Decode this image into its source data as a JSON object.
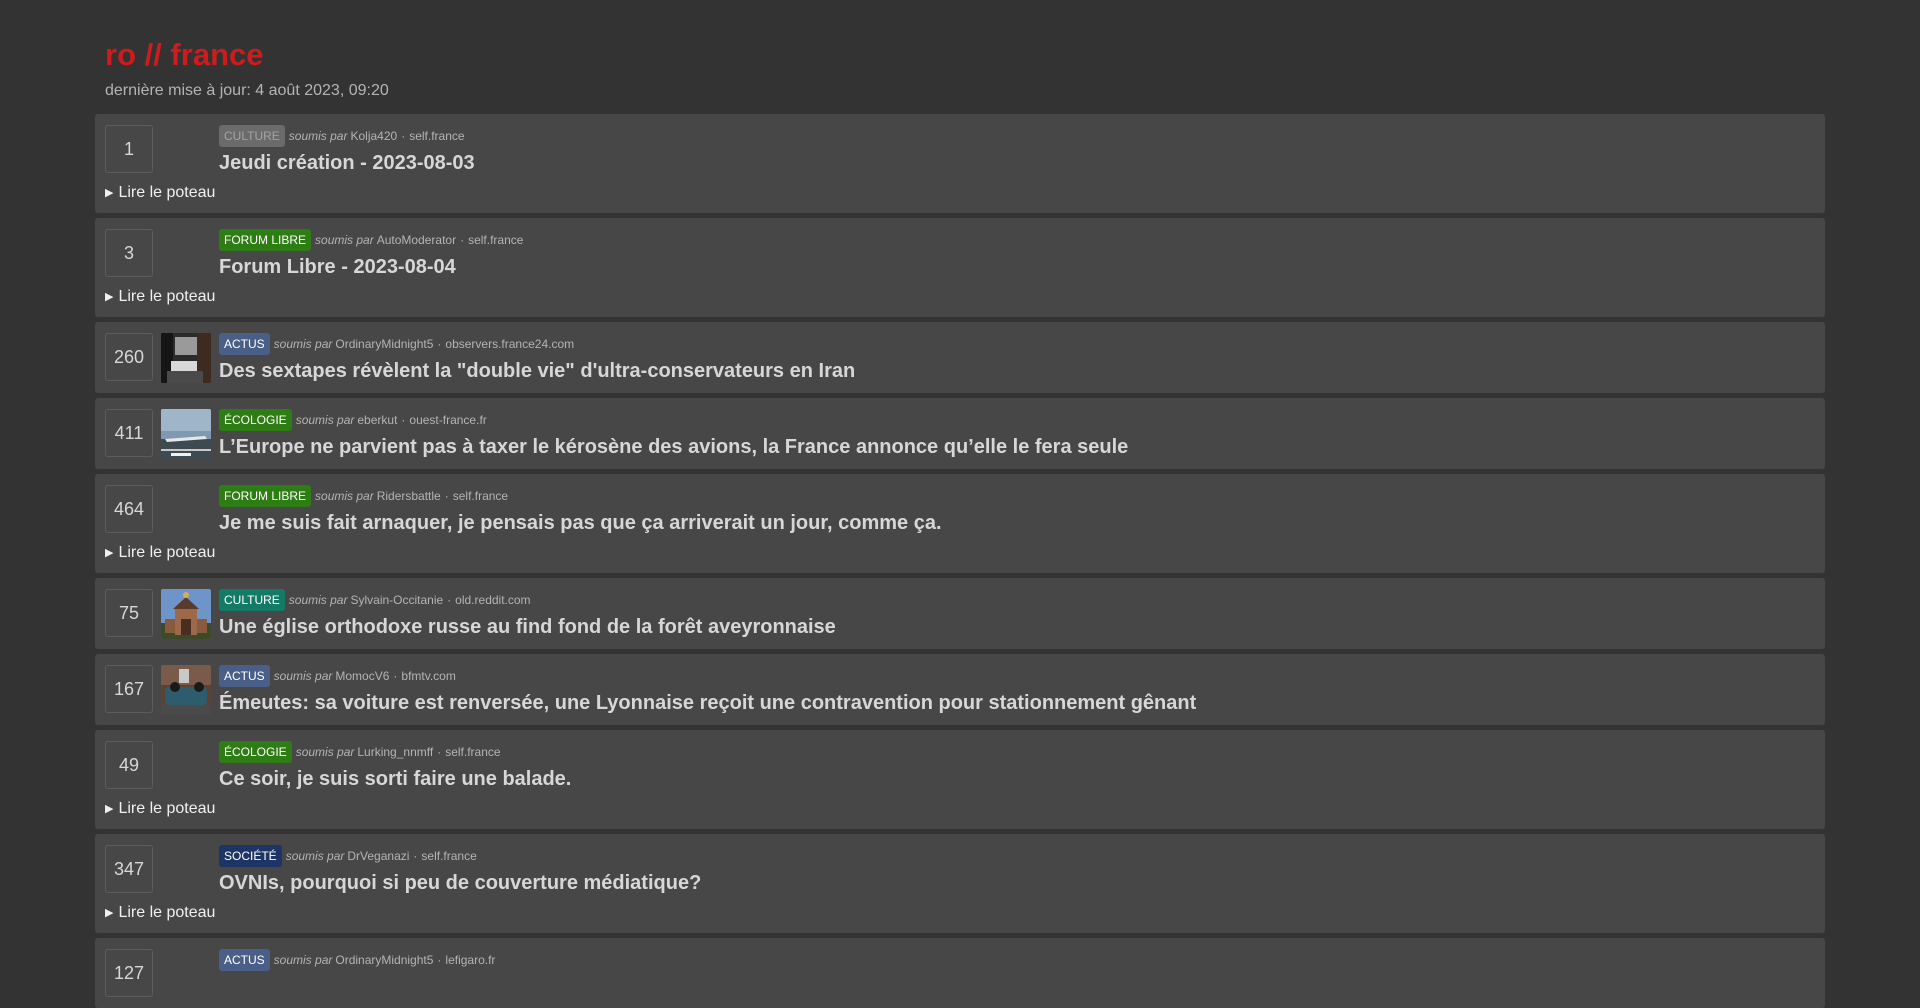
{
  "site": {
    "title": "ro // france",
    "updated": "dernière mise à jour: 4 août 2023, 09:20"
  },
  "labels": {
    "submitted_by": "soumis par",
    "separator": "·",
    "read_post": "Lire le poteau"
  },
  "posts": [
    {
      "score": "1",
      "flair": "CULTURE",
      "flair_color": "#6b6b6b",
      "flair_text_color": "#a3a3a3",
      "author": "Kolja420",
      "domain": "self.france",
      "title": "Jeudi création - 2023-08-03",
      "thumb": "none",
      "expandable": true
    },
    {
      "score": "3",
      "flair": "FORUM LIBRE",
      "flair_color": "#2e7d14",
      "author": "AutoModerator",
      "domain": "self.france",
      "title": "Forum Libre - 2023-08-04",
      "thumb": "none",
      "expandable": true
    },
    {
      "score": "260",
      "flair": "ACTUS",
      "flair_color": "#4a5f88",
      "author": "OrdinaryMidnight5",
      "domain": "observers.france24.com",
      "title": "Des sextapes révèlent la \"double vie\" d'ultra-conservateurs en Iran",
      "thumb": "room",
      "expandable": false
    },
    {
      "score": "411",
      "flair": "ÉCOLOGIE",
      "flair_color": "#2e7d14",
      "author": "eberkut",
      "domain": "ouest-france.fr",
      "title": "L’Europe ne parvient pas à taxer le kérosène des avions, la France annonce qu’elle le fera seule",
      "thumb": "plane",
      "expandable": false
    },
    {
      "score": "464",
      "flair": "FORUM LIBRE",
      "flair_color": "#2e7d14",
      "author": "Ridersbattle",
      "domain": "self.france",
      "title": "Je me suis fait arnaquer, je pensais pas que ça arriverait un jour, comme ça.",
      "thumb": "none",
      "expandable": true
    },
    {
      "score": "75",
      "flair": "CULTURE",
      "flair_color": "#137a66",
      "author": "Sylvain-Occitanie",
      "domain": "old.reddit.com",
      "title": "Une église orthodoxe russe au find fond de la forêt aveyronnaise",
      "thumb": "church",
      "expandable": false
    },
    {
      "score": "167",
      "flair": "ACTUS",
      "flair_color": "#4a5f88",
      "author": "MomocV6",
      "domain": "bfmtv.com",
      "title": "Émeutes: sa voiture est renversée, une Lyonnaise reçoit une contravention pour stationnement gênant",
      "thumb": "car",
      "expandable": false
    },
    {
      "score": "49",
      "flair": "ÉCOLOGIE",
      "flair_color": "#2e7d14",
      "author": "Lurking_nnmff",
      "domain": "self.france",
      "title": "Ce soir, je suis sorti faire une balade.",
      "thumb": "none",
      "expandable": true
    },
    {
      "score": "347",
      "flair": "SOCIÉTÉ",
      "flair_color": "#1d3566",
      "author": "DrVeganazi",
      "domain": "self.france",
      "title": "OVNIs, pourquoi si peu de couverture médiatique?",
      "thumb": "none",
      "expandable": true
    },
    {
      "score": "127",
      "flair": "ACTUS",
      "flair_color": "#4a5f88",
      "author": "OrdinaryMidnight5",
      "domain": "lefigaro.fr",
      "title": "",
      "thumb": "none",
      "expandable": false
    }
  ]
}
